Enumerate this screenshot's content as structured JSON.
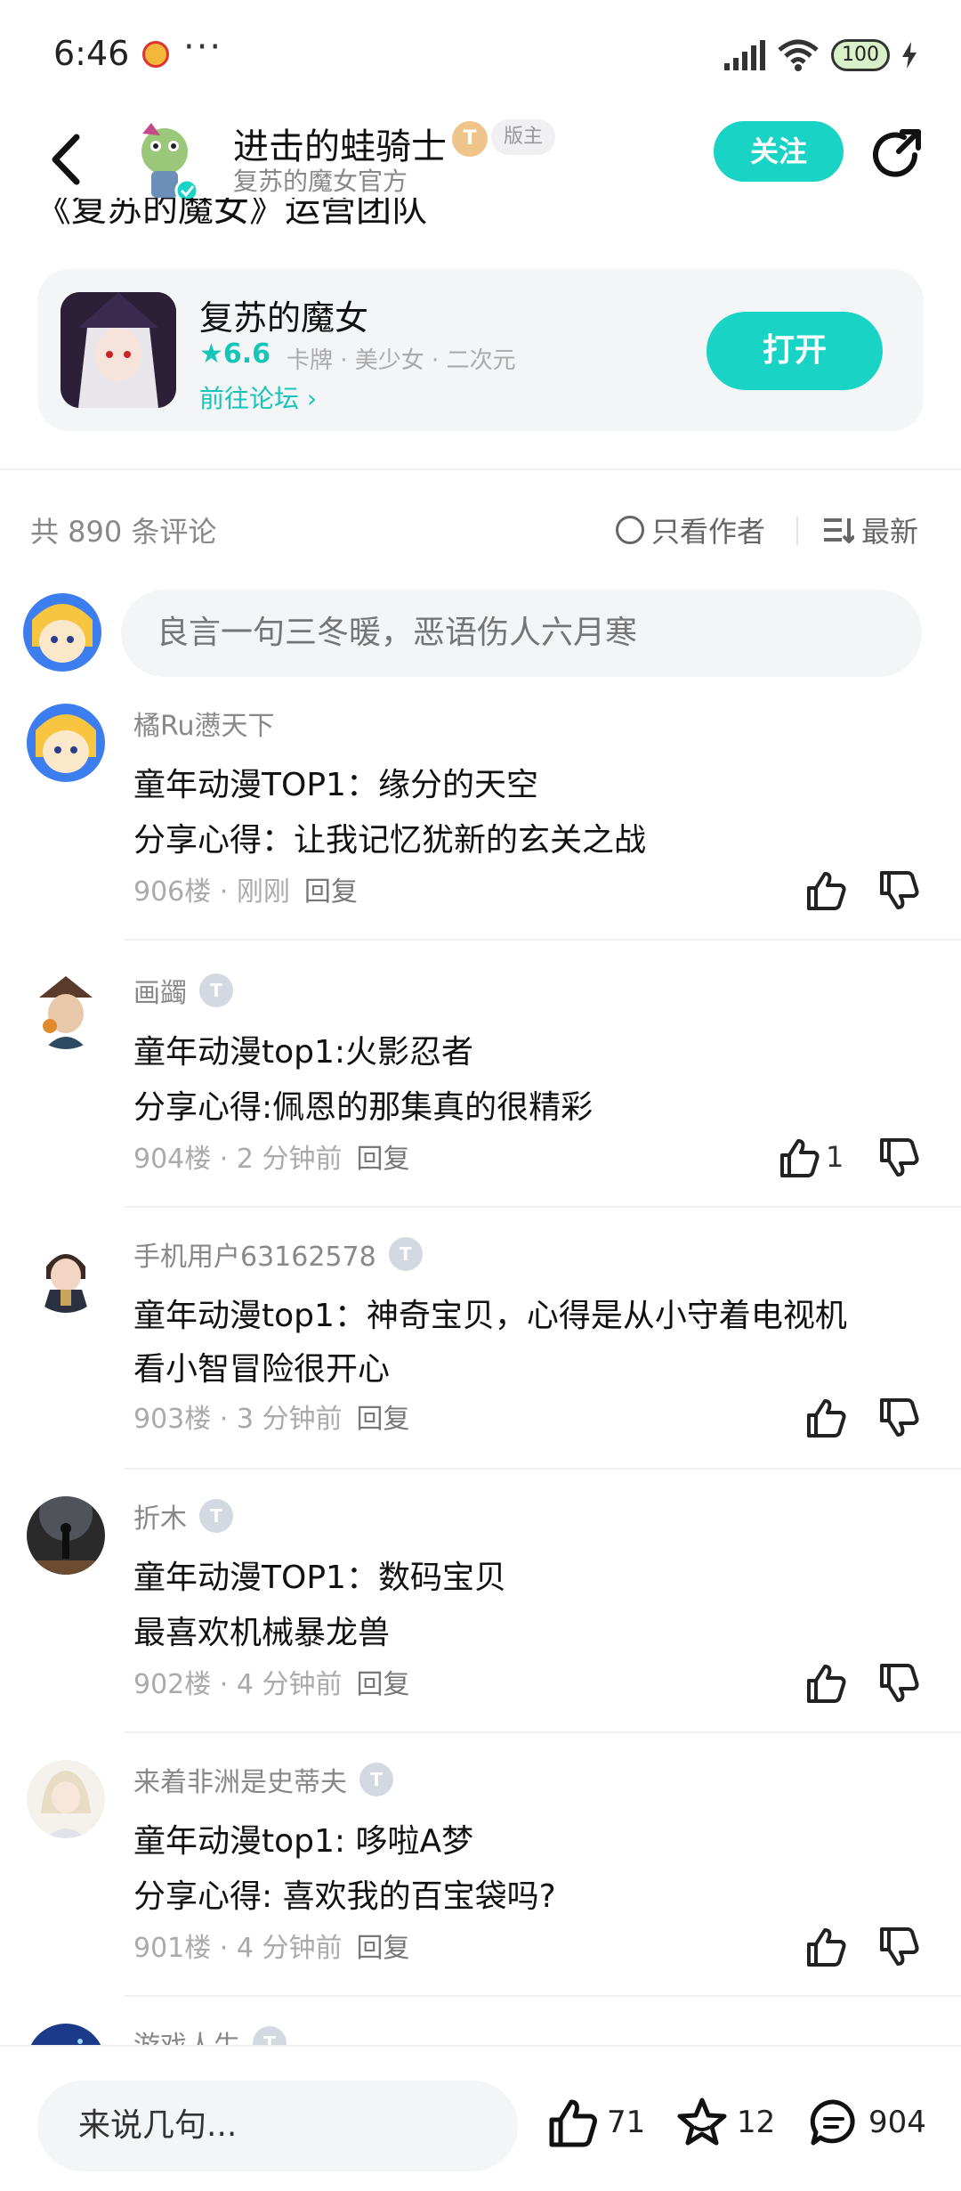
{
  "status_bar": {
    "time": "6:46",
    "more": "···",
    "battery": "100"
  },
  "header": {
    "username": "进击的蛙骑士",
    "level": "T",
    "role_tag": "版主",
    "subtitle": "复苏的魔女官方",
    "follow_label": "关注"
  },
  "post_title_cut": "《复苏的魔女》运营团队",
  "game": {
    "name": "复苏的魔女",
    "rating": "★6.6",
    "tags": "卡牌 · 美少女 · 二次元",
    "forum_link": "前往论坛 ›",
    "open_label": "打开"
  },
  "comments_bar": {
    "count": "共 890 条评论",
    "author_only": "只看作者",
    "sort": "最新"
  },
  "comment_input_placeholder": "良言一句三冬暖，恶语伤人六月寒",
  "comments": [
    {
      "user": "橘Ru懑天下",
      "level": "",
      "lines": [
        "童年动漫TOP1：缘分的天空",
        "分享心得：让我记忆犹新的玄关之战"
      ],
      "floor": "906楼",
      "time": "刚刚",
      "reply": "回复",
      "likes": ""
    },
    {
      "user": "画蠲",
      "level": "T",
      "lines": [
        "童年动漫top1:火影忍者",
        "分享心得:佩恩的那集真的很精彩"
      ],
      "floor": "904楼",
      "time": "2 分钟前",
      "reply": "回复",
      "likes": "1"
    },
    {
      "user": "手机用户63162578",
      "level": "T",
      "lines": [
        "童年动漫top1：神奇宝贝，心得是从小守着电视机",
        "看小智冒险很开心"
      ],
      "floor": "903楼",
      "time": "3 分钟前",
      "reply": "回复",
      "likes": ""
    },
    {
      "user": "折木",
      "level": "T",
      "lines": [
        "童年动漫TOP1：数码宝贝",
        "最喜欢机械暴龙兽"
      ],
      "floor": "902楼",
      "time": "4 分钟前",
      "reply": "回复",
      "likes": ""
    },
    {
      "user": "来着非洲是史蒂夫",
      "level": "T",
      "lines": [
        "童年动漫top1: 哆啦A梦",
        "分享心得: 喜欢我的百宝袋吗?"
      ],
      "floor": "901楼",
      "time": "4 分钟前",
      "reply": "回复",
      "likes": ""
    },
    {
      "user": "游戏人生",
      "level": "T",
      "lines": [],
      "floor": "",
      "time": "",
      "reply": "",
      "likes": ""
    }
  ],
  "bottom_bar": {
    "input_placeholder": "来说几句...",
    "likes": "71",
    "favorites": "12",
    "comments": "904"
  },
  "colors": {
    "accent": "#19d3c5",
    "text_primary": "#111111",
    "text_secondary": "#888888"
  }
}
